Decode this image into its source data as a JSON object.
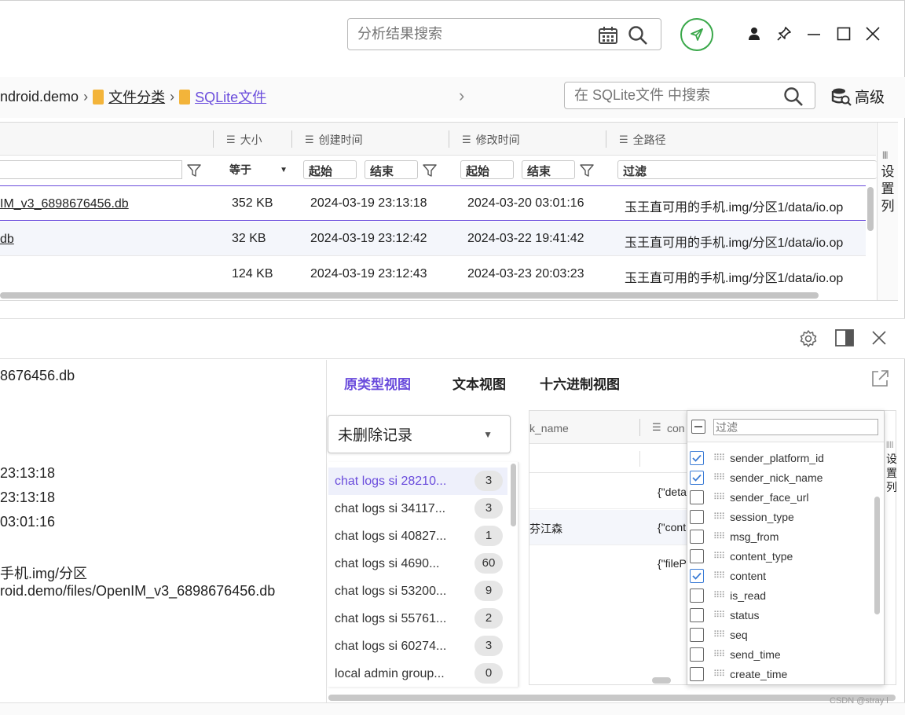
{
  "header": {
    "search_placeholder": "分析结果搜索",
    "icons": [
      "calendar-icon",
      "search-icon",
      "rocket-icon",
      "user-icon",
      "pin-icon",
      "minimize-icon",
      "maximize-icon",
      "close-icon"
    ]
  },
  "breadcrumb": {
    "items": [
      "ndroid.demo",
      "文件分类",
      "SQLite文件"
    ],
    "search_placeholder": "在 SQLite文件 中搜索",
    "advanced_label": "高级"
  },
  "table": {
    "columns": [
      "大小",
      "创建时间",
      "修改时间",
      "全路径"
    ],
    "filters": {
      "size_op": "等于",
      "created_start": "起始",
      "created_end": "结束",
      "modified_start": "起始",
      "modified_end": "结束",
      "path": "过滤"
    },
    "settings_label": [
      "设",
      "置",
      "列"
    ],
    "rows": [
      {
        "name": "IM_v3_6898676456.db",
        "size": "352 KB",
        "created": "2024-03-19 23:13:18",
        "modified": "2024-03-20 03:01:16",
        "path": "玉王直可用的手机.img/分区1/data/io.op"
      },
      {
        "name": "db",
        "size": "32 KB",
        "created": "2024-03-19 23:12:42",
        "modified": "2024-03-22 19:41:42",
        "path": "玉王直可用的手机.img/分区1/data/io.op"
      },
      {
        "name": "",
        "size": "124 KB",
        "created": "2024-03-19 23:12:43",
        "modified": "2024-03-23 20:03:23",
        "path": "玉王直可用的手机.img/分区1/data/io.op"
      }
    ]
  },
  "details": {
    "lines": [
      "8676456.db",
      "23:13:18",
      "23:13:18",
      "03:01:16",
      "手机.img/分区",
      "roid.demo/files/OpenIM_v3_6898676456.db"
    ]
  },
  "viewer": {
    "tabs": [
      "原类型视图",
      "文本视图",
      "十六进制视图"
    ],
    "record_select": "未删除记录",
    "tables": [
      {
        "name": "chat logs si 28210...",
        "count": "3"
      },
      {
        "name": "chat logs si 34117...",
        "count": "3"
      },
      {
        "name": "chat logs si 40827...",
        "count": "1"
      },
      {
        "name": "chat logs si 4690...",
        "count": "60"
      },
      {
        "name": "chat logs si 53200...",
        "count": "9"
      },
      {
        "name": "chat logs si 55761...",
        "count": "2"
      },
      {
        "name": "chat logs si 60274...",
        "count": "3"
      },
      {
        "name": "local admin group...",
        "count": "0"
      }
    ],
    "grid": {
      "col1": "k_name",
      "col2": "con",
      "cells": [
        "{\"deta",
        "芬江森",
        "{\"cont",
        "{\"fileP"
      ]
    },
    "column_picker": {
      "filter_placeholder": "过滤",
      "settings_label": [
        "设",
        "置",
        "列"
      ],
      "items": [
        {
          "label": "sender_platform_id",
          "checked": true
        },
        {
          "label": "sender_nick_name",
          "checked": true
        },
        {
          "label": "sender_face_url",
          "checked": false
        },
        {
          "label": "session_type",
          "checked": false
        },
        {
          "label": "msg_from",
          "checked": false
        },
        {
          "label": "content_type",
          "checked": false
        },
        {
          "label": "content",
          "checked": true
        },
        {
          "label": "is_read",
          "checked": false
        },
        {
          "label": "status",
          "checked": false
        },
        {
          "label": "seq",
          "checked": false
        },
        {
          "label": "send_time",
          "checked": false
        },
        {
          "label": "create_time",
          "checked": false
        }
      ]
    }
  },
  "watermark": "CSDN @stray l",
  "colors": {
    "accent": "#6a4cdc",
    "link": "#2b6fd6",
    "green": "#3aa84a",
    "check": "#3a7bd5"
  }
}
